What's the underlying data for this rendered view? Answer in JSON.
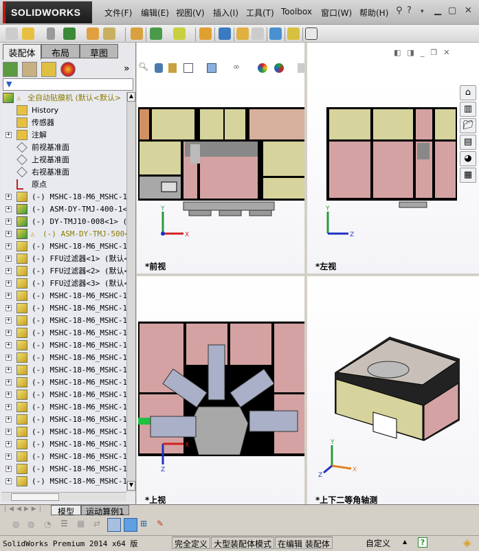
{
  "app": {
    "logo": "SOLIDWORKS",
    "menu": [
      "文件(F)",
      "编辑(E)",
      "视图(V)",
      "插入(I)",
      "工具(T)",
      "Toolbox",
      "窗口(W)",
      "帮助(H)"
    ]
  },
  "left_panel": {
    "tabs": [
      "装配体",
      "布局",
      "草图"
    ],
    "expand_label": "»",
    "filter_icon": "filter-icon",
    "tree": [
      {
        "label": "全自动贴膜机  (默认<默认>",
        "icon": "assembly",
        "warn": true,
        "root": true
      },
      {
        "label": "History",
        "icon": "history"
      },
      {
        "label": "传感器",
        "icon": "sensor"
      },
      {
        "label": "注解",
        "icon": "annotation",
        "exp": true
      },
      {
        "label": "前视基准面",
        "icon": "plane"
      },
      {
        "label": "上视基准面",
        "icon": "plane"
      },
      {
        "label": "右视基准面",
        "icon": "plane"
      },
      {
        "label": "原点",
        "icon": "origin"
      },
      {
        "label": "(-) MSHC-18-M6_MSHC-18-",
        "icon": "part",
        "exp": true
      },
      {
        "label": "(-) ASM-DY-TMJ-400-1<1>",
        "icon": "assembly",
        "exp": true
      },
      {
        "label": "(-) DY-TMJ10-008<1> (默",
        "icon": "assembly",
        "exp": true
      },
      {
        "label": "(-) ASM-DY-TMJ-500<1",
        "icon": "assembly",
        "exp": true,
        "warn": true
      },
      {
        "label": "(-) MSHC-18-M6_MSHC-18-",
        "icon": "part",
        "exp": true
      },
      {
        "label": "(-) FFU过滤器<1> (默认<",
        "icon": "part",
        "exp": true
      },
      {
        "label": "(-) FFU过滤器<2> (默认<",
        "icon": "part",
        "exp": true
      },
      {
        "label": "(-) FFU过滤器<3> (默认<",
        "icon": "part",
        "exp": true
      },
      {
        "label": "(-) MSHC-18-M6_MSHC-18-",
        "icon": "part",
        "exp": true
      },
      {
        "label": "(-) MSHC-18-M6_MSHC-18-",
        "icon": "part",
        "exp": true
      },
      {
        "label": "(-) MSHC-18-M6_MSHC-18-",
        "icon": "part",
        "exp": true
      },
      {
        "label": "(-) MSHC-18-M6_MSHC-18-",
        "icon": "part",
        "exp": true
      },
      {
        "label": "(-) MSHC-18-M6_MSHC-18-",
        "icon": "part",
        "exp": true
      },
      {
        "label": "(-) MSHC-18-M6_MSHC-18-",
        "icon": "part",
        "exp": true
      },
      {
        "label": "(-) MSHC-18-M6_MSHC-18-",
        "icon": "part",
        "exp": true
      },
      {
        "label": "(-) MSHC-18-M6_MSHC-18-",
        "icon": "part",
        "exp": true
      },
      {
        "label": "(-) MSHC-18-M6_MSHC-18-",
        "icon": "part",
        "exp": true
      },
      {
        "label": "(-) MSHC-18-M6_MSHC-18-",
        "icon": "part",
        "exp": true
      },
      {
        "label": "(-) MSHC-18-M6_MSHC-18-",
        "icon": "part",
        "exp": true
      },
      {
        "label": "(-) MSHC-18-M6_MSHC-18-",
        "icon": "part",
        "exp": true
      },
      {
        "label": "(-) MSHC-18-M6_MSHC-18-",
        "icon": "part",
        "exp": true
      },
      {
        "label": "(-) MSHC-18-M6_MSHC-18-",
        "icon": "part",
        "exp": true
      },
      {
        "label": "(-) MSHC-18-M6_MSHC-18-",
        "icon": "part",
        "exp": true
      },
      {
        "label": "(-) MSHC-18-M6_MSHC-18-",
        "icon": "part",
        "exp": true
      }
    ]
  },
  "viewports": {
    "front": "*前视",
    "left": "*左视",
    "top": "*上视",
    "iso": "*上下二等角轴测"
  },
  "axes": {
    "x": "X",
    "y": "Y",
    "z": "Z"
  },
  "bottom_tabs": [
    "模型",
    "运动算例1"
  ],
  "status": {
    "product": "SolidWorks Premium 2014 x64 版",
    "defined": "完全定义",
    "mode": "大型装配体模式",
    "editing": "在编辑 装配体",
    "units": "自定义",
    "help": "?"
  },
  "colors": {
    "tan": "#d6d39c",
    "pink": "#d4a2a2",
    "salmon": "#d6b09c",
    "gray": "#a8a8a8",
    "accent": "#c01818"
  }
}
